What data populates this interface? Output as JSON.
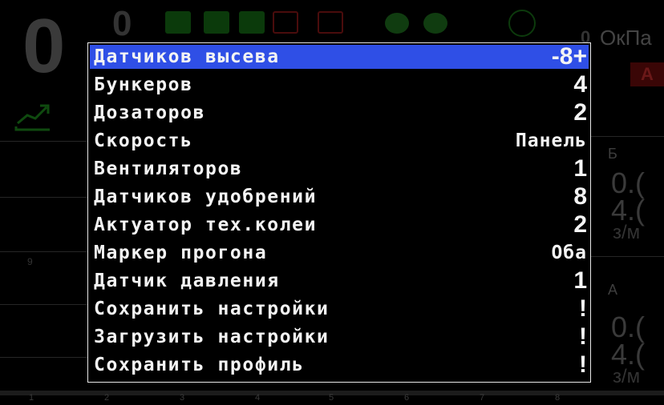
{
  "background": {
    "big_digit": "0",
    "small_digit": "0",
    "top_right_text": "ОкПа",
    "top_right_prefix": "0",
    "alert_label": "A",
    "right_panel": {
      "section1_label": "Б",
      "section1_value1": "0.(",
      "section1_value2": "4.(",
      "section1_unit": "з/м",
      "section2_label": "А",
      "section2_value1": "0.(",
      "section2_value2": "4.(",
      "section2_unit": "з/м"
    },
    "left_grid_label": "9",
    "bottom_ticks": [
      "1",
      "2",
      "3",
      "4",
      "5",
      "6",
      "7",
      "8"
    ],
    "colors": {
      "dim_green": "#0b3a0b",
      "dim_red": "#4a0c0c"
    }
  },
  "menu": {
    "selected_color": "#2f4fe6",
    "items": [
      {
        "label": "Датчиков высева",
        "value": "-8+",
        "selected": true
      },
      {
        "label": "Бункеров",
        "value": "4"
      },
      {
        "label": "Дозаторов",
        "value": "2"
      },
      {
        "label": "Скорость",
        "value": "Панель"
      },
      {
        "label": "Вентиляторов",
        "value": "1"
      },
      {
        "label": "Датчиков удобрений",
        "value": "8"
      },
      {
        "label": "Актуатор тех.колеи",
        "value": "2"
      },
      {
        "label": "Маркер прогона",
        "value": "Оба"
      },
      {
        "label": "Датчик давления",
        "value": "1"
      },
      {
        "label": "Сохранить настройки",
        "value": "!"
      },
      {
        "label": "Загрузить настройки",
        "value": "!"
      },
      {
        "label": "Сохранить профиль",
        "value": "!"
      }
    ]
  }
}
